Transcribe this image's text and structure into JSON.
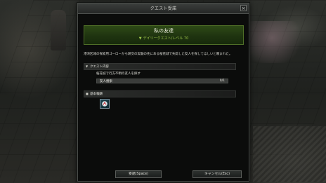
{
  "dialog": {
    "title": "クエスト受諾",
    "close_label": "×"
  },
  "quest": {
    "name": "私の友達",
    "type_label": "デイリークエスト/レベル 70",
    "description": "港湾区域の探索用ゴーローから跡交の実験の先にある桜花城で失踪した友人を探してほしいと頼まれた。"
  },
  "sections": {
    "quest_content": "クエスト内容",
    "reward": "基本報酬"
  },
  "objective": {
    "text": "桜花城で行方不明の友人を探す",
    "progress_label": "友人捜索",
    "progress_count": "0/1",
    "progress_fraction": 0.0
  },
  "buttons": {
    "accept": "受諾(Space)",
    "cancel": "キャンセル(Esc)"
  },
  "colors": {
    "banner_accent": "#9cc34a",
    "reward_icon_border": "#7a8f9c"
  },
  "icons": {
    "close": "close-icon",
    "reward": "reward-item-icon"
  }
}
